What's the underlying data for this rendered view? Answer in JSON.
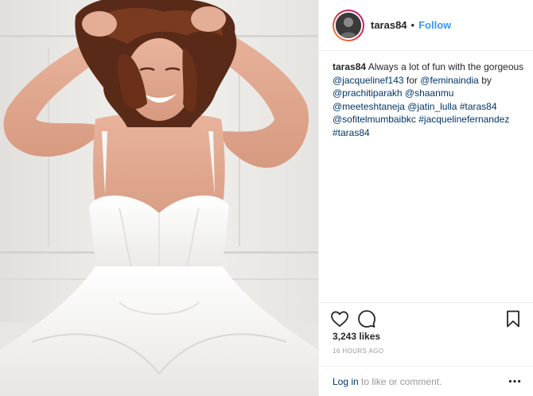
{
  "post": {
    "username": "taras84",
    "separator": "•",
    "follow_label": "Follow",
    "caption": {
      "line1_text": "Always a lot of fun with the gorgeous",
      "tag_jacqueline": "@jacquelinef143",
      "word_for": "for",
      "tag_femina": "@feminaindia",
      "word_by": "by",
      "tag_prachiti": "@prachitiparakh",
      "tag_shaanmu": "@shaanmu",
      "tag_meetesh": "@meeteshtaneja",
      "tag_jatin": "@jatin_lulla",
      "hashtag_taras": "#taras84",
      "tag_sofitel": "@sofitelmumbaibkc",
      "hashtag_jacqueline": "#jacquelinefernandez",
      "hashtag_taras2": "#taras84"
    },
    "likes": "3,243 likes",
    "timestamp": "16 HOURS AGO",
    "comment": {
      "login_label": "Log in",
      "suffix": " to like or comment."
    },
    "icons": {
      "like": "heart-icon",
      "comment": "comment-bubble-icon",
      "save": "bookmark-icon",
      "more": "more-options-icon"
    },
    "colors": {
      "follow_blue": "#3897f0",
      "link_navy": "#003569",
      "muted_gray": "#999999",
      "text_dark": "#262626"
    }
  }
}
